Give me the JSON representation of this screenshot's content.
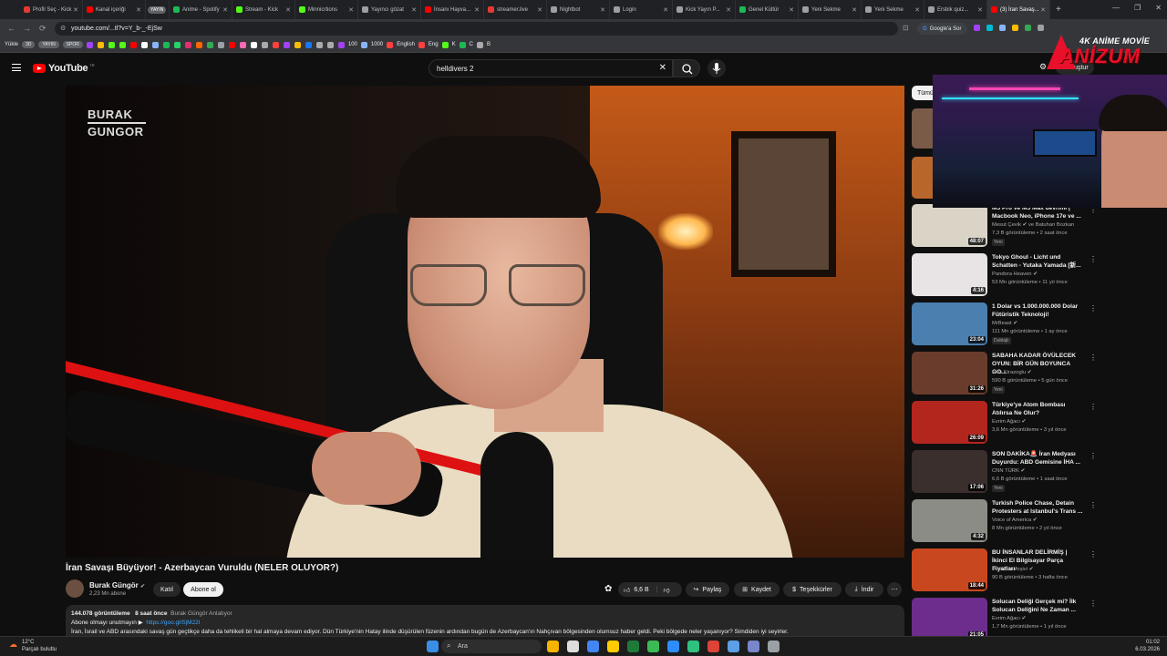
{
  "browser": {
    "tabs": [
      {
        "label": "Profil Seç - Kick",
        "color": "#e53935"
      },
      {
        "label": "Kanal içeriği",
        "color": "#ff0000"
      },
      {
        "label": "YAYIN",
        "color": "#5f6368",
        "pill": true
      },
      {
        "label": "Anime - Spotify",
        "color": "#1db954"
      },
      {
        "label": "Stream - Kick",
        "color": "#53fc18"
      },
      {
        "label": "Minnicrtions",
        "color": "#53fc18"
      },
      {
        "label": "Yayıncı gözat",
        "color": "#9aa0a6"
      },
      {
        "label": "İnsanı Hayva...",
        "color": "#ff0000"
      },
      {
        "label": "streamer.live",
        "color": "#e53935"
      },
      {
        "label": "Nightbot",
        "color": "#9aa0a6"
      },
      {
        "label": "Login",
        "color": "#9aa0a6"
      },
      {
        "label": "Kick Yayın P...",
        "color": "#9aa0a6"
      },
      {
        "label": "Genel Kültür",
        "color": "#1db954"
      },
      {
        "label": "Yeni Sekme",
        "color": "#9aa0a6"
      },
      {
        "label": "Yeni Sekme",
        "color": "#9aa0a6"
      },
      {
        "label": "Ersbik quiz...",
        "color": "#9aa0a6"
      },
      {
        "label": "(3) İran Savaş...",
        "color": "#ff0000",
        "active": true
      }
    ],
    "new_tab": "+",
    "url": "youtube.com/...tl?v=Y_b-_-EjSw",
    "google_btn": "Google'a Sor",
    "bookmarks": {
      "first": "Yükle",
      "pill1": "3D",
      "pill2": "YAYIN",
      "pill3": "SPOR",
      "labels": [
        "100",
        "1000",
        "English",
        "Eng",
        "K",
        "C",
        "B"
      ]
    }
  },
  "yt": {
    "logo_text": "YouTube",
    "logo_sup": "TR",
    "search_value": "helldivers 2",
    "create_label": "Oluştur"
  },
  "video": {
    "brand_line1": "BURAK",
    "brand_line2": "GUNGOR",
    "title": "İran Savaşı Büyüyor! - Azerbaycan Vuruldu (NELER OLUYOR?)",
    "channel": "Burak Güngör",
    "subscribers": "2,23 Mn abone",
    "join": "Katıl",
    "subscribe": "Abone ol",
    "likes": "6,6 B",
    "share": "Paylaş",
    "save": "Kaydet",
    "thanks": "Teşekkürler",
    "download": "İndir",
    "views": "144.078 görüntüleme",
    "ago": "8 saat önce",
    "desc_author": "Burak Güngör Anlatıyor",
    "desc_line2": "Abone olmayı unutmayın ▶",
    "desc_link": "https://goo.gl/SjM22l",
    "desc_line3": "İran, İsrail ve ABD arasındaki savaş gün geçtikçe daha da tehlikeli bir hal almaya devam ediyor. Dün Türkiye'nin Hatay ilinde düşürülen füzenin ardından bugün de Azerbaycan'ın Nahçıvan bölgesinden olumsuz haber geldi. Peki bölgede neler yaşanıyor? Simdiden iyi seyirler."
  },
  "sidebar": {
    "chip": "Tümü",
    "items": [
      {
        "title": "M5 Pro ve M5 Max devrimi | Macbook Neo, iPhone 17e ve ...",
        "channel": "Mesut Çevik ✔ ve Batuhan Bozkan",
        "meta": "7,3 B görüntüleme • 2 saat önce",
        "badge": "Yeni",
        "duration": "48:07",
        "thumb": "#d9d4c6"
      },
      {
        "title": "Tokyo Ghoul - Licht und Schatten - Yutaka Yamada [新...",
        "channel": "Pandora Heaven ✔",
        "meta": "53 Mn görüntüleme • 11 yıl önce",
        "badge": "",
        "duration": "4:16",
        "thumb": "#e8e4e6"
      },
      {
        "title": "1 Dolar vs 1.000.000.000 Dolar Fütüristik Teknoloji!",
        "channel": "MrBeast ✔",
        "meta": "111 Mn görüntüleme • 1 ay önce",
        "badge": "Dublajlı",
        "duration": "23:04",
        "thumb": "#4a7fb0"
      },
      {
        "title": "SABAHA KADAR ÖVÜLECEK OYUN: BİR GÜN BOYUNCA GO...",
        "channel": "Enis Kirazoglu ✔",
        "meta": "590 B görüntüleme • 5 gün önce",
        "badge": "Yeni",
        "duration": "31:26",
        "thumb": "#6a3c2c"
      },
      {
        "title": "Türkiye'ye Atom Bombası Atılırsa Ne Olur?",
        "channel": "Evrim Ağacı ✔",
        "meta": "3,6 Mn görüntüleme • 3 yıl önce",
        "badge": "",
        "duration": "26:09",
        "thumb": "#b3261e"
      },
      {
        "title": "SON DAKİKA🚨 İran Medyası Duyurdu: ABD Gemisine İHA ...",
        "channel": "CNN TÜRK ✔",
        "meta": "6,6 B görüntüleme • 1 saat önce",
        "badge": "Yeni",
        "duration": "17:06",
        "thumb": "#3a2f2c"
      },
      {
        "title": "Turkish Police Chase, Detain Protesters at Istanbul's Trans ...",
        "channel": "Voice of America ✔",
        "meta": "8 Mn görüntüleme • 2 yıl önce",
        "badge": "",
        "duration": "4:32",
        "thumb": "#8c8c86"
      },
      {
        "title": "BU İNSANLAR DELİRMİŞ | İkinci El Bilgisayar Parça Fiyatları",
        "channel": "Donanım Arşivi ✔",
        "meta": "90 B görüntüleme • 3 hafta önce",
        "badge": "",
        "duration": "18:44",
        "thumb": "#c9471e"
      },
      {
        "title": "Solucan Deliği Gerçek mi? İlk Solucan Deliğini Ne Zaman ...",
        "channel": "Evrim Ağacı ✔",
        "meta": "1,7 Mn görüntüleme • 1 yıl önce",
        "badge": "",
        "duration": "21:05",
        "thumb": "#6d2d8c"
      }
    ]
  },
  "overlay": {
    "logo_top": "4K ANİME MOVİE",
    "logo_main": "ANİZUM"
  },
  "taskbar": {
    "weather_temp": "12°C",
    "weather_desc": "Parçalı bulutlu",
    "search": "Ara",
    "time": "01:02",
    "date": "6.03.2026"
  }
}
